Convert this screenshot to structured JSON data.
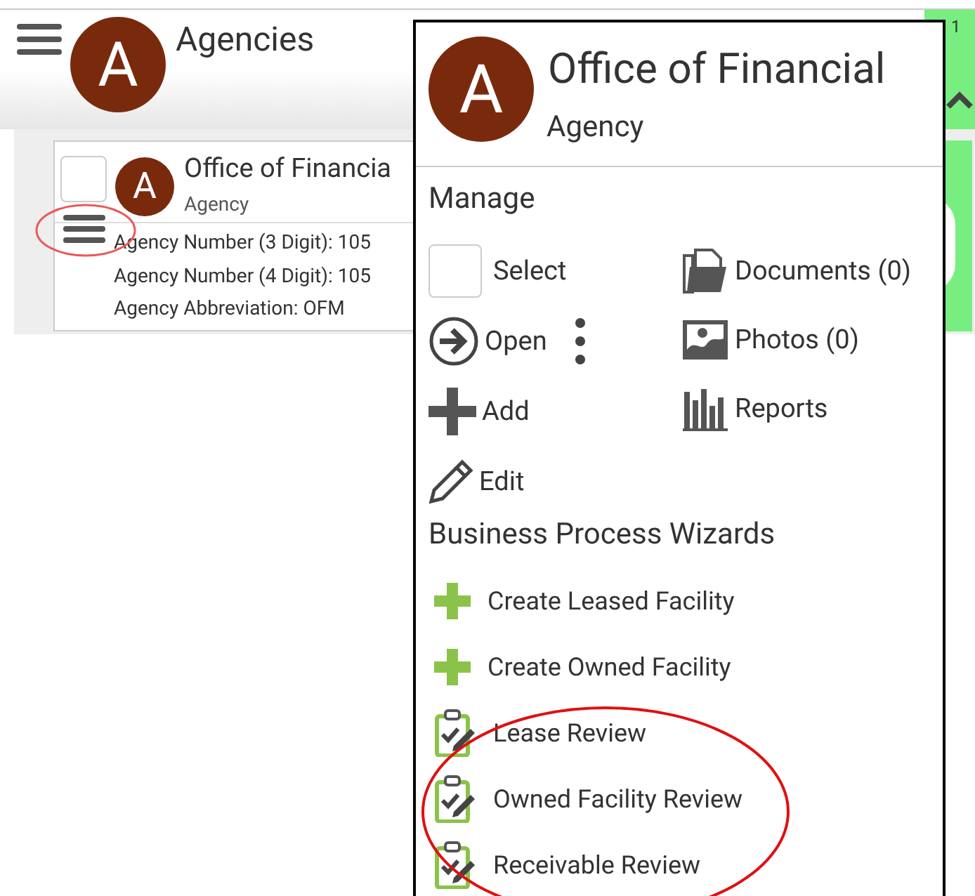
{
  "header": {
    "avatar_letter": "A",
    "title": "Agencies"
  },
  "corner_badge": "1",
  "agency_card": {
    "checked": false,
    "avatar_letter": "A",
    "name": "Office of Financia",
    "type": "Agency",
    "fields": [
      "Agency Number (3 Digit): 105",
      "Agency Number (4 Digit): 105",
      "Agency Abbreviation: OFM"
    ]
  },
  "menu": {
    "avatar_letter": "A",
    "title": "Office of Financial",
    "subtitle": "Agency",
    "manage_heading": "Manage",
    "manage_left": [
      {
        "kind": "checkbox",
        "label": "Select",
        "checked": false
      },
      {
        "kind": "open",
        "label": "Open"
      },
      {
        "kind": "add",
        "label": "Add"
      },
      {
        "kind": "edit",
        "label": "Edit"
      }
    ],
    "manage_right": [
      {
        "kind": "documents",
        "label": "Documents (0)"
      },
      {
        "kind": "photos",
        "label": "Photos (0)"
      },
      {
        "kind": "reports",
        "label": "Reports"
      }
    ],
    "wizards_heading": "Business Process Wizards",
    "wizards": [
      {
        "kind": "create",
        "label": "Create Leased Facility"
      },
      {
        "kind": "create",
        "label": "Create Owned Facility"
      },
      {
        "kind": "review",
        "label": "Lease Review"
      },
      {
        "kind": "review",
        "label": "Owned Facility Review"
      },
      {
        "kind": "review",
        "label": "Receivable Review"
      }
    ]
  }
}
